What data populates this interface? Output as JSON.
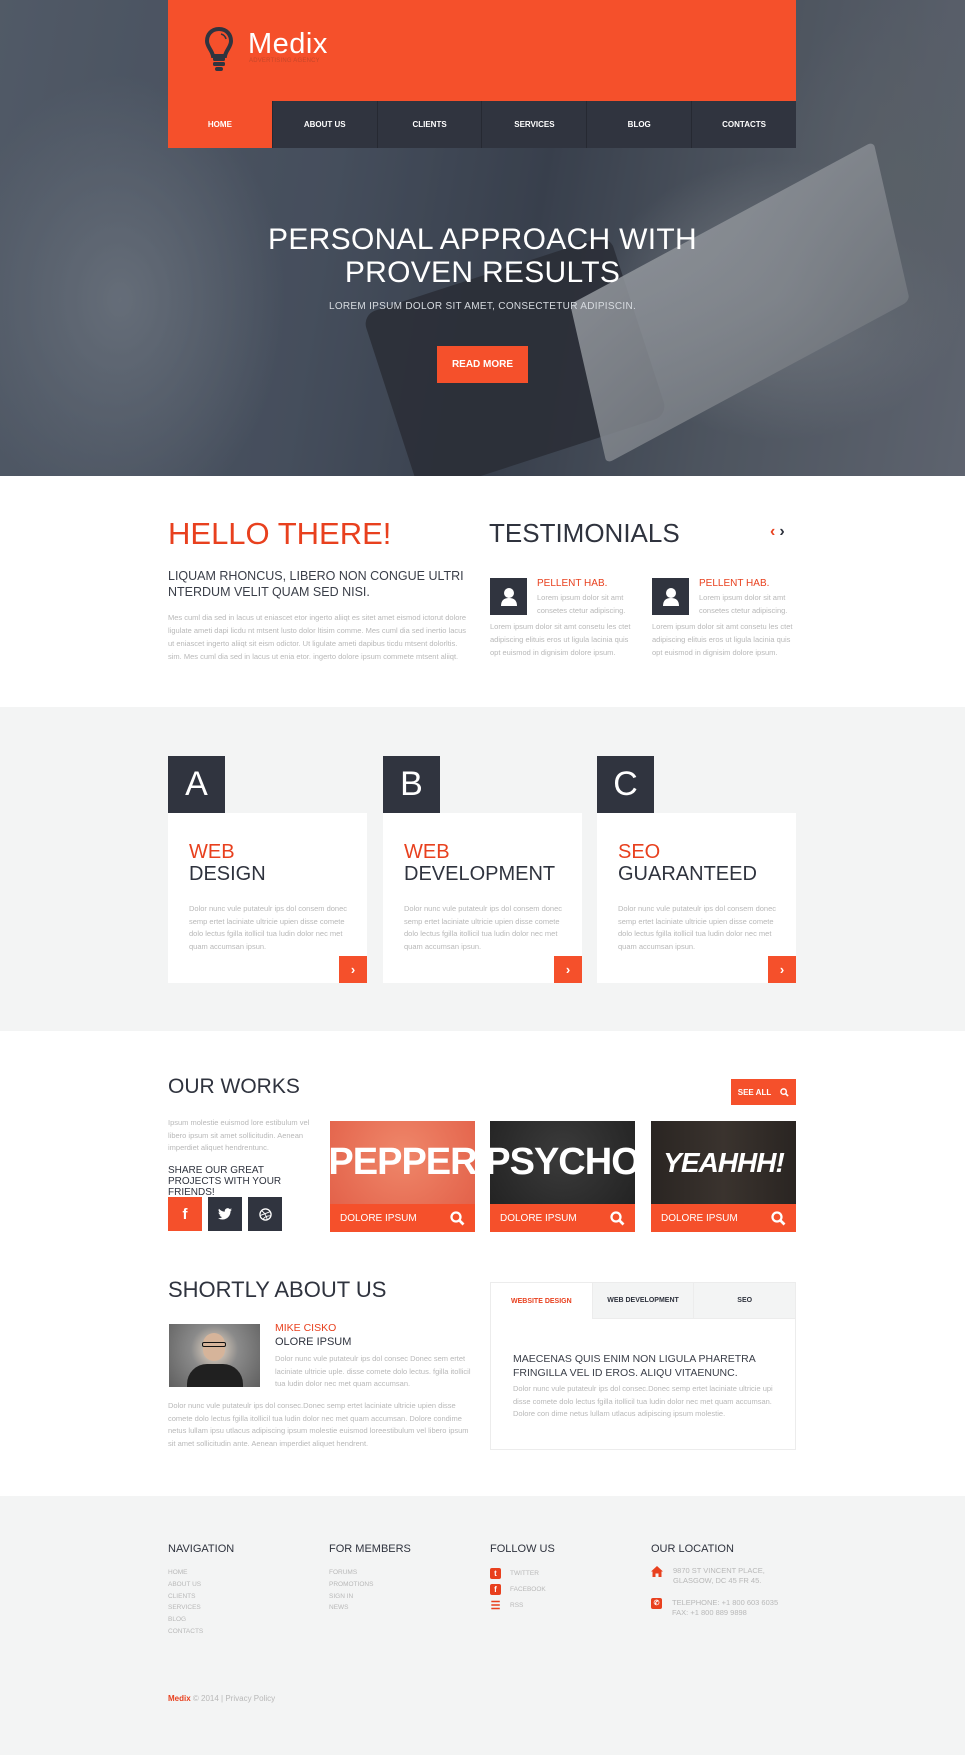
{
  "brand": {
    "name": "Medix",
    "tagline": "ADVERTISING AGENCY",
    "accent": "#f5502b",
    "dark": "#30343f"
  },
  "nav": {
    "items": [
      "HOME",
      "ABOUT US",
      "CLIENTS",
      "SERVICES",
      "BLOG",
      "CONTACTS"
    ],
    "active": "HOME"
  },
  "hero": {
    "title_line1": "PERSONAL APPROACH WITH",
    "title_line2": "PROVEN RESULTS",
    "subtitle": "LOREM IPSUM DOLOR SIT AMET, CONSECTETUR ADIPISCIN.",
    "button": "READ MORE"
  },
  "hello": {
    "title": "HELLO THERE!",
    "subtitle": "LIQUAM RHONCUS, LIBERO NON CONGUE ULTRI NTERDUM VELIT QUAM SED NISI.",
    "body": "Mes cuml dia sed in lacus ut eniascet etor ingerto aliiqt es sitet amet eismod ictorut dolore ligulate ameti dapi licdu nt mtsent lusto dolor ltisim comme. Mes cuml dia sed inertio lacus ut eniascet ingerto aliiqt sit eism odictor. Ut ligulate ameti dapibus ticdu mtsent dolorltis. sim. Mes cuml dia sed in lacus ut enia etor. ingerto dolore ipsum commete mtsent aliiqt."
  },
  "testimonials": {
    "title": "TESTIMONIALS",
    "prev": "‹",
    "next": "›",
    "items": [
      {
        "name": "PELLENT HAB.",
        "short": "Lorem ipsum dolor sit amt consetes ctetur adipiscing.",
        "body": "Lorem ipsum dolor sit amt consetu les ctet adipiscing elituis eros ut ligula lacinia quis opt euismod in dignisim dolore ipsum."
      },
      {
        "name": "PELLENT HAB.",
        "short": "Lorem ipsum dolor sit amt consetes ctetur adipiscing.",
        "body": "Lorem ipsum dolor sit amt consetu les ctet adipiscing elituis eros ut ligula lacinia quis opt euismod in dignisim dolore ipsum."
      }
    ]
  },
  "services": [
    {
      "letter": "A",
      "title1": "WEB",
      "title2": "DESIGN",
      "body": "Dolor nunc vule putateulr ips dol consem donec semp ertet laciniate ultricie upien disse comete dolo lectus fgilla itollicil tua ludin dolor nec met quam accumsan ipsun.",
      "button": "›"
    },
    {
      "letter": "B",
      "title1": "WEB",
      "title2": "DEVELOPMENT",
      "body": "Dolor nunc vule putateulr ips dol consem donec semp ertet laciniate ultricie upien disse comete dolo lectus fgilla itollicil tua ludin dolor nec met quam accumsan ipsun.",
      "button": "›"
    },
    {
      "letter": "C",
      "title1": "SEO",
      "title2": "GUARANTEED",
      "body": "Dolor nunc vule putateulr ips dol consem donec semp ertet laciniate ultricie upien disse comete dolo lectus fgilla itollicil tua ludin dolor nec met quam accumsan ipsun.",
      "button": "›"
    }
  ],
  "works": {
    "title": "OUR WORKS",
    "see_all": "SEE ALL",
    "body": "Ipsum molestie euismod lore estibulum vel libero ipsum sit amet sollicitudin. Aenean imperdiet aliquet hendrentunc.",
    "share": "SHARE OUR GREAT PROJECTS WITH YOUR FRIENDS!",
    "social": [
      "facebook",
      "twitter",
      "dribbble"
    ],
    "items": [
      {
        "image_text": "PEPPER",
        "label": "DOLORE IPSUM"
      },
      {
        "image_text": "PSYCHO",
        "label": "DOLORE IPSUM"
      },
      {
        "image_text": "YEAHHH!",
        "label": "DOLORE IPSUM"
      }
    ]
  },
  "about": {
    "title": "SHORTLY ABOUT US",
    "person_name": "MIKE CISKO",
    "person_role": "OLORE IPSUM",
    "person_body": "Dolor nunc vule putateulr ips dol consec Donec sem ertet laciniate ultricie uple. disse comete dolo lectus. fgilla itollicil tua ludin dolor nec met quam accumsan.",
    "body": "Dolor nunc vule putateulr ips dol consec.Donec semp ertet laciniate ultricie upien disse comete dolo lectus fgilla itollicil tua ludin dolor nec met quam accumsan. Dolore condime netus lullam ipsu utlacus adipiscing ipsum molestie euismod loreestibulum vel libero ipsum sit amet sollicitudin ante. Aenean imperdiet aliquet hendrent."
  },
  "tabs": {
    "items": [
      "WEBSITE DESIGN",
      "WEB DEVELOPMENT",
      "SEO"
    ],
    "active": "WEBSITE DESIGN",
    "heading": "MAECENAS QUIS ENIM NON LIGULA PHARETRA FRINGILLA VEL ID EROS. ALIQU VITAENUNC.",
    "body": "Dolor nunc vule putateulr ips dol consec.Donec semp ertet laciniate ultricie upi disse comete dolo lectus fgilla itollicil tua ludin dolor nec met quam accumsan. Dolore con dime netus lullam utlacus adipiscing ipsum molestie."
  },
  "footer": {
    "navigation": {
      "title": "NAVIGATION",
      "links": [
        "HOME",
        "ABOUT US",
        "CLIENTS",
        "SERVICES",
        "BLOG",
        "CONTACTS"
      ]
    },
    "members": {
      "title": "FOR MEMBERS",
      "links": [
        "FORUMS",
        "PROMOTIONS",
        "SIGN IN",
        "NEWS"
      ]
    },
    "follow": {
      "title": "FOLLOW US",
      "links": [
        {
          "icon": "twitter",
          "label": "TWITTER"
        },
        {
          "icon": "facebook",
          "label": "FACEBOOK"
        },
        {
          "icon": "rss",
          "label": "RSS"
        }
      ]
    },
    "location": {
      "title": "OUR LOCATION",
      "address_line1": "9870 ST VINCENT PLACE,",
      "address_line2": "GLASGOW, DC 45 FR 45.",
      "phone": "TELEPHONE: +1 800 603 6035",
      "fax": "FAX: +1 800 889 9898"
    },
    "copyright_brand": "Medix",
    "copyright": "© 2014 | ",
    "privacy": "Privacy Policy"
  }
}
